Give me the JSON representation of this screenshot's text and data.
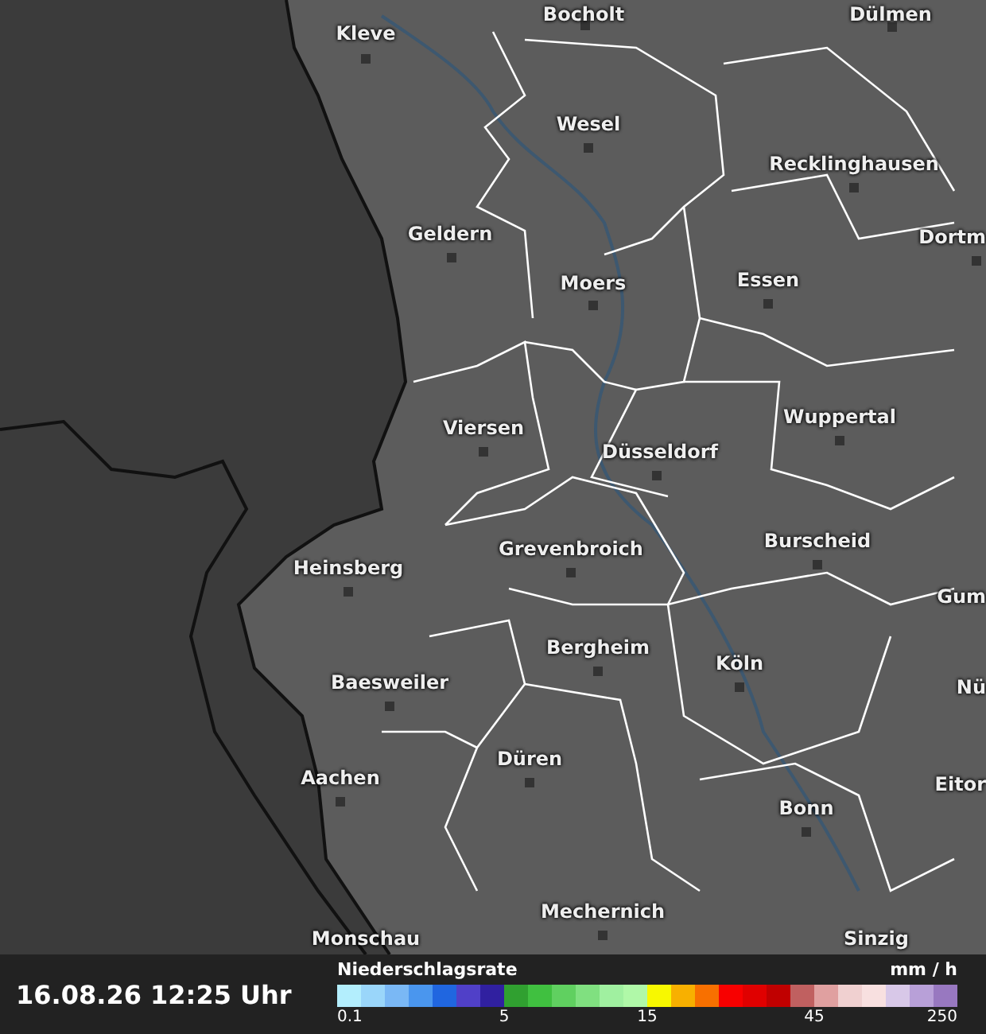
{
  "map": {
    "cities": [
      {
        "name": "Bocholt"
      },
      {
        "name": "Dülmen"
      },
      {
        "name": "Kleve"
      },
      {
        "name": "Wesel"
      },
      {
        "name": "Recklinghausen"
      },
      {
        "name": "Dortm"
      },
      {
        "name": "Geldern"
      },
      {
        "name": "Moers"
      },
      {
        "name": "Essen"
      },
      {
        "name": "Viersen"
      },
      {
        "name": "Wuppertal"
      },
      {
        "name": "Düsseldorf"
      },
      {
        "name": "Grevenbroich"
      },
      {
        "name": "Burscheid"
      },
      {
        "name": "Heinsberg"
      },
      {
        "name": "Gum"
      },
      {
        "name": "Bergheim"
      },
      {
        "name": "Köln"
      },
      {
        "name": "Baesweiler"
      },
      {
        "name": "Nü"
      },
      {
        "name": "Düren"
      },
      {
        "name": "Aachen"
      },
      {
        "name": "Eitor"
      },
      {
        "name": "Bonn"
      },
      {
        "name": "Mechernich"
      },
      {
        "name": "Monschau"
      },
      {
        "name": "Sinzig"
      }
    ]
  },
  "footer": {
    "timestamp": "16.08.26 12:25 Uhr",
    "legend": {
      "title": "Niederschlagsrate",
      "unit": "mm / h",
      "swatches": [
        {
          "color": "#b3eefd",
          "label": "0.1"
        },
        {
          "color": "#9ad6fa"
        },
        {
          "color": "#7ab8f5"
        },
        {
          "color": "#4a96ee"
        },
        {
          "color": "#2066e0"
        },
        {
          "color": "#5040c8"
        },
        {
          "color": "#3020a0"
        },
        {
          "color": "#30a030",
          "label": "5"
        },
        {
          "color": "#40c040"
        },
        {
          "color": "#60d060"
        },
        {
          "color": "#80e080"
        },
        {
          "color": "#a0f0a0"
        },
        {
          "color": "#b0f8a8"
        },
        {
          "color": "#f8f800",
          "label": "15"
        },
        {
          "color": "#f8b000"
        },
        {
          "color": "#f87000"
        },
        {
          "color": "#f80000"
        },
        {
          "color": "#e00000"
        },
        {
          "color": "#c00000"
        },
        {
          "color": "#c06060"
        },
        {
          "color": "#e0a0a0",
          "label": "45"
        },
        {
          "color": "#f0d0d0"
        },
        {
          "color": "#f8e0e0"
        },
        {
          "color": "#d8c8e8"
        },
        {
          "color": "#b8a0d8"
        },
        {
          "color": "#9878c0",
          "label": "250"
        }
      ]
    }
  }
}
